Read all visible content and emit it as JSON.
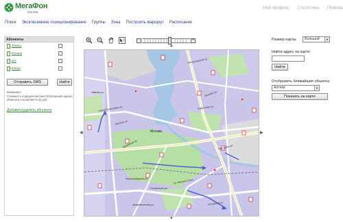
{
  "brand": {
    "name": "МегаФон",
    "region": "Москва"
  },
  "top_links": [
    "Мой профиль",
    "Статистика",
    "Помощь"
  ],
  "nav": [
    "Поиск",
    "Эксклюзивное позиционирование",
    "Группы",
    "Зона",
    "Построить маршрут",
    "Расписание"
  ],
  "subscribers_panel": {
    "title": "Абоненты",
    "items": [
      {
        "name": "Ивана"
      },
      {
        "name": "Ксюша"
      },
      {
        "name": "кот"
      },
      {
        "name": "Юля2"
      }
    ],
    "send_sms_label": "Отправить SMS",
    "find_label": "Найти",
    "note_heading": "Внимание!",
    "note_text": "Стоимость определения местоположения одного абонента составляет 5,31 руб.",
    "add_remove_link": "Добавить/удалить абонента"
  },
  "map_toolbar": {
    "icons": [
      "zoom-in-icon",
      "zoom-out-icon",
      "pan-hand-icon",
      "help-cursor-icon"
    ],
    "zoom_minus": "-",
    "zoom_plus": "+",
    "zoom_level": 0.58
  },
  "map": {
    "city_label": "Москва",
    "street_labels": [
      "Ленинградское ш.",
      "Беговая ул.",
      "Ходынская ул.",
      "Нижняя ул.",
      "Вятская ул.",
      "Бумажный пр.",
      "Новая Башиловка ул.",
      "Приорова ул.",
      "Кировоградская ул.",
      "ул. Ямского Поля",
      "Головинская ул.",
      "Хуторская ул.",
      "Академическая ул."
    ],
    "colors": {
      "residential": "#c7c4e8",
      "park": "#b9dfa7",
      "water": "#a7c6e6",
      "road": "#ffffff",
      "marker": "#d23c3c",
      "route": "#4f5fd0"
    }
  },
  "right_panel": {
    "map_size_label": "Размер карты:",
    "map_size_value": "Большой",
    "address_label": "Найти адрес на карте:",
    "address_value": "",
    "find_label": "Найти",
    "nearby_label": "Отобразить ближайшие объекты:",
    "nearby_value": "Аптеки",
    "show_on_map_label": "Показать на карте"
  }
}
